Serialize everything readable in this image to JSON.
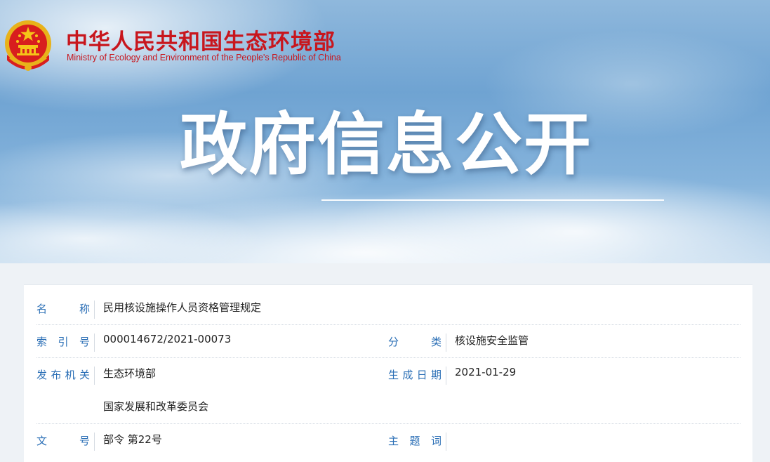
{
  "header": {
    "site_title": "中华人民共和国生态环境部",
    "site_subtitle": "Ministry of Ecology and Environment of the People's Republic of China",
    "hero_title": "政府信息公开",
    "logo_icon": "national-emblem-icon"
  },
  "colors": {
    "brand_red": "#c8161d",
    "label_blue": "#2b6fb6",
    "sky_blue": "#6fa3d2"
  },
  "info": {
    "name_label": "名　称",
    "name_value": "民用核设施操作人员资格管理规定",
    "index_label": "索引号",
    "index_value": "000014672/2021-00073",
    "category_label": "分　类",
    "category_value": "核设施安全监管",
    "issuer_label": "发布机关",
    "issuer_value_1": "生态环境部",
    "issuer_value_2": "国家发展和改革委员会",
    "date_label": "生成日期",
    "date_value": "2021-01-29",
    "doc_no_label": "文　号",
    "doc_no_value": "部令 第22号",
    "keywords_label": "主题词",
    "keywords_value": ""
  }
}
